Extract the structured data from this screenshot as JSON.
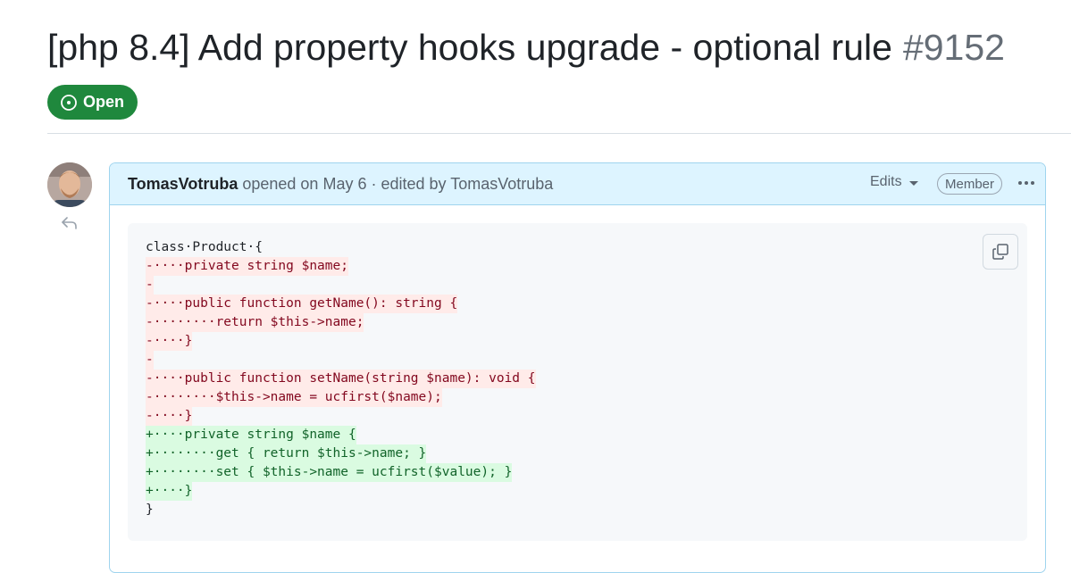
{
  "issue": {
    "title": "[php 8.4] Add property hooks upgrade - optional rule",
    "number": "#9152",
    "state_label": "Open",
    "state_color": "#1f883d"
  },
  "comment": {
    "author": "TomasVotruba",
    "meta": "opened on May 6 · edited by TomasVotruba",
    "edits_label": "Edits",
    "role_badge": "Member",
    "avatar_icon": "user-avatar",
    "reply_icon": "reply-icon",
    "copy_icon": "copy-icon",
    "more_icon": "kebab-horizontal-icon"
  },
  "code_lines": [
    {
      "kind": "ctx",
      "text": "class·Product·{"
    },
    {
      "kind": "del",
      "text": "-····private string $name;"
    },
    {
      "kind": "del",
      "text": "-"
    },
    {
      "kind": "del",
      "text": "-····public function getName(): string {"
    },
    {
      "kind": "del",
      "text": "-········return $this->name;"
    },
    {
      "kind": "del",
      "text": "-····}"
    },
    {
      "kind": "del",
      "text": "-"
    },
    {
      "kind": "del",
      "text": "-····public function setName(string $name): void {"
    },
    {
      "kind": "del",
      "text": "-········$this->name = ucfirst($name);"
    },
    {
      "kind": "del",
      "text": "-····}"
    },
    {
      "kind": "add",
      "text": "+····private string $name {"
    },
    {
      "kind": "add",
      "text": "+········get { return $this->name; }"
    },
    {
      "kind": "add",
      "text": "+········set { $this->name = ucfirst($value); }"
    },
    {
      "kind": "add",
      "text": "+····}"
    },
    {
      "kind": "ctx",
      "text": "}"
    }
  ]
}
